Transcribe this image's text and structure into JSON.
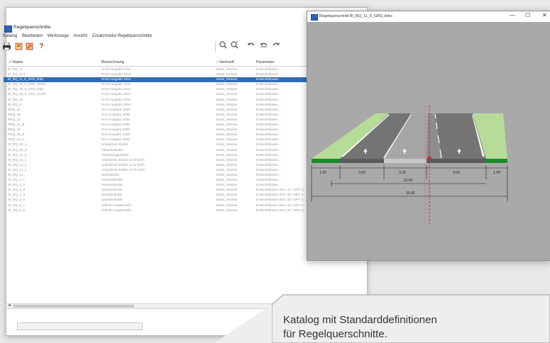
{
  "main_window": {
    "title": "Regelquerschnitte",
    "menu": [
      "Katalog",
      "Bearbeiten",
      "Werkzeuge",
      "Ansicht",
      "Zusatzmodul Regelquerschnitte"
    ],
    "toolbar_icons": [
      "print-icon",
      "catalog-icon",
      "catalog-edit-icon",
      "help-icon",
      "zoom-in-icon",
      "zoom-out-icon",
      "undo-icon",
      "undo-all-icon",
      "redo-icon"
    ],
    "table": {
      "columns": [
        "Name",
        "Bezeichnung",
        "Herkunft",
        "Parameter"
      ],
      "rows": [
        [
          "Bl_RQ_11",
          "RASt Ausgabe 2012",
          "Basis_Strasse",
          "Entwurfsklasse..."
        ],
        [
          "Bl_RQ_11.5",
          "RASt Ausgabe 2012",
          "Basis_Strasse",
          "Entwurfsklasse..."
        ],
        [
          "Bl_RQ_11_5_GRS_links",
          "RASt Ausgabe 2012",
          "Basis_Strasse",
          "Entwurfsklasse..."
        ],
        [
          "Bl_RQ_11_5_GRS_rechts",
          "RASt Ausgabe 2012",
          "Basis_Strasse",
          "Entwurfsklasse..."
        ],
        [
          "Bl_RQ_15_5_GRS_links",
          "RASt Ausgabe 2012",
          "Basis_Strasse",
          "Entwurfsklasse..."
        ],
        [
          "Bl_RQ_15_5_GRS_rechts",
          "RASt Ausgabe 2012",
          "Basis_Strasse",
          "Entwurfsklasse..."
        ],
        [
          "Bl_RQ_21",
          "RASt Ausgabe 2012",
          "Basis_Strasse",
          "Entwurfsklasse..."
        ],
        [
          "Bl_RQ_9",
          "RASt Ausgabe 2012",
          "Basis_Strasse",
          "Entwurfsklasse..."
        ],
        [
          "RRQ_21",
          "RAA Ausgabe 2008",
          "Basis_Strasse",
          "Entwurfsklasse..."
        ],
        [
          "RRQ_28",
          "RAA Ausgabe 2008",
          "Basis_Strasse",
          "Entwurfsklasse..."
        ],
        [
          "RRQ_31",
          "RAA Ausgabe 2008",
          "Basis_Strasse",
          "Entwurfsklasse..."
        ],
        [
          "RRQ_31_B",
          "RAA Ausgabe 2008",
          "Basis_Strasse",
          "Entwurfsklasse..."
        ],
        [
          "RRQ_36",
          "RAA Ausgabe 2008",
          "Basis_Strasse",
          "Entwurfsklasse..."
        ],
        [
          "RRQ_36_B",
          "RAA Ausgabe 2008",
          "Basis_Strasse",
          "Entwurfsklasse..."
        ],
        [
          "RRQ_43_5",
          "RAA Ausgabe 2008",
          "Basis_Strasse",
          "Entwurfsklasse..."
        ],
        [
          "St_RQ_10_1",
          "Anbaufreie Straße",
          "Basis_Strasse",
          "Entwurfsklasse..."
        ],
        [
          "St_RQ_10_5",
          "Industriestraße",
          "Basis_Strasse",
          "Entwurfsklasse..."
        ],
        [
          "St_RQ_11_6",
          "Verbindungsstraße",
          "Basis_Strasse",
          "Entwurfsklasse..."
        ],
        [
          "St_RQ_12_1",
          "Anbaufreie Straße vz 50 km/h",
          "Basis_Strasse",
          "Entwurfsklasse..."
        ],
        [
          "St_RQ_12_2",
          "Anbaufreie Straße vz 50 km/h",
          "Basis_Strasse",
          "Entwurfsklasse..."
        ],
        [
          "St_RQ_12_4",
          "Anbaufreie Straße vz 70 km/h",
          "Basis_Strasse",
          "Entwurfsklasse..."
        ],
        [
          "St_RQ_21",
          "Wohnstraße",
          "Basis_Strasse",
          "Entwurfsklasse..."
        ],
        [
          "St_RQ_2_1",
          "Sammelstraße",
          "Basis_Strasse",
          "Entwurfsklasse..."
        ],
        [
          "St_RQ_2_3",
          "Sammelstraße",
          "Basis_Strasse",
          "Entwurfsklasse..."
        ],
        [
          "St_RQ_4_2",
          "Quartierstraße",
          "Basis_Strasse",
          "Entwurfsklasse (EKL III) / DRV 4,..."
        ],
        [
          "St_RQ_4_4",
          "Quartierstraße",
          "Basis_Strasse",
          "Entwurfsklasse (EKL III) / DRV 4,..."
        ],
        [
          "St_RQ_6_5",
          "Quartierstraße",
          "Basis_Strasse",
          "Entwurfsklasse (EKL III) / DRV 4,..."
        ],
        [
          "St_RQ_5_7",
          "Örtliche Hauptstraße",
          "Basis_Strasse",
          "Entwurfsklasse (EKL III) / DRV 4,..."
        ],
        [
          "St_RQ_5_8",
          "Örtliche Hauptstraße",
          "Basis_Strasse",
          "Entwurfsklasse (EKL III) / DRV 4,..."
        ]
      ],
      "selected_index": 2
    }
  },
  "preview_window": {
    "title": "Regelquerschnitt Bl_RQ_11_5_GRS_links",
    "controls": [
      "—",
      "☐",
      "✕"
    ],
    "dimensions": {
      "top_row": [
        "1.50",
        "3.00",
        "3.25",
        "3.00",
        "1.50"
      ],
      "mid": "12.00",
      "bottom": "15.00"
    },
    "colors": {
      "verge": "#b6dc98",
      "verge_edge": "#1a8a2c",
      "asphalt": "#747474",
      "asphalt_light": "#a6a6a6",
      "background": "#a9a9a9",
      "axis": "#b01c1c"
    }
  },
  "caption": {
    "line1": "Katalog mit Standarddefinitionen",
    "line2": "für Regelquerschnitte."
  }
}
